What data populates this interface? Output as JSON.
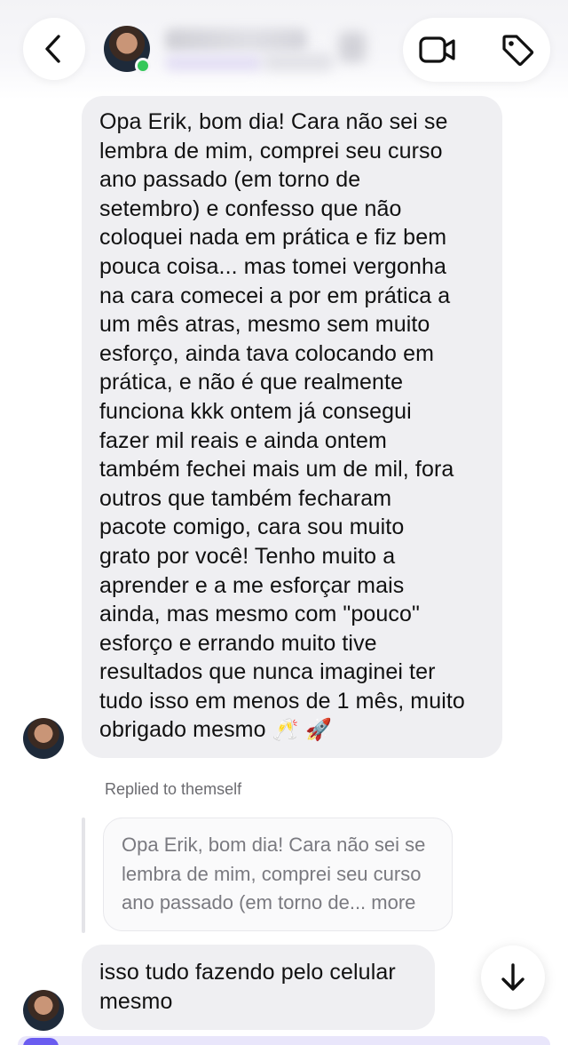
{
  "header": {
    "icons": [
      "back-arrow-icon",
      "video-call-icon",
      "tag-icon"
    ],
    "online_status_color": "#34c759"
  },
  "message_1": {
    "lines": [
      "Opa Erik, bom dia! Cara não sei se",
      "lembra de mim, comprei seu curso",
      "ano passado (em torno de",
      "setembro) e  confesso que não",
      "coloquei nada em prática e fiz bem",
      "pouca coisa... mas tomei vergonha",
      "na cara comecei a por em prática a",
      "um mês atras, mesmo sem muito",
      "esforço, ainda tava colocando em",
      "prática, e não é que realmente",
      "funciona kkk ontem já consegui",
      "fazer mil reais e ainda ontem",
      "também fechei mais um de mil, fora",
      "outros que também fecharam",
      "pacote comigo, cara sou muito",
      "grato por você! Tenho muito a",
      "aprender e a me esforçar mais",
      "ainda, mas mesmo com \"pouco\"",
      "esforço e errando muito tive",
      "resultados que nunca imaginei ter",
      "tudo isso em menos de 1 mês, muito",
      "obrigado mesmo"
    ],
    "emojis": "🥂 🚀"
  },
  "reply": {
    "label": "Replied to themself",
    "quote_lines": [
      "Opa Erik, bom dia! Cara não sei se",
      "lembra de mim, comprei seu curso",
      "ano passado (em torno de... more"
    ]
  },
  "message_2": {
    "lines": [
      "isso tudo fazendo pelo celular",
      "mesmo"
    ]
  },
  "colors": {
    "bubble": "#efeff2",
    "accent": "#6a5cf0"
  }
}
